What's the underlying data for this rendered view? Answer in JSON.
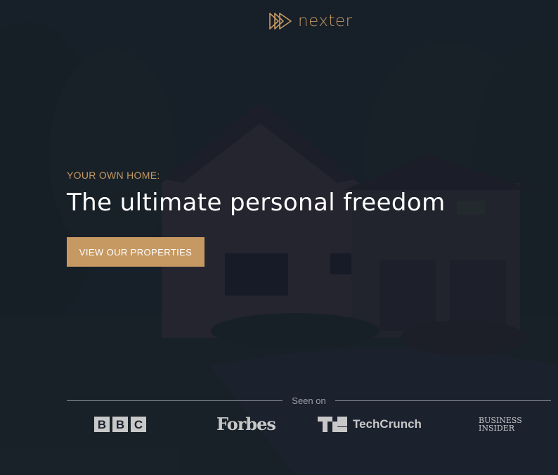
{
  "brand": {
    "name": "nexter",
    "logo_icon": "nexter-play-triangles-icon"
  },
  "hero": {
    "eyebrow": "YOUR OWN HOME:",
    "headline": "The ultimate personal freedom",
    "cta_label": "VIEW OUR PROPERTIES",
    "background_image": "house-at-dusk-photo"
  },
  "seen_on": {
    "label": "Seen on",
    "brands": [
      "BBC",
      "Forbes",
      "TechCrunch",
      "BUSINESS",
      "INSIDER"
    ]
  },
  "colors": {
    "accent": "#c69963",
    "overlay": "#10182a",
    "headline": "#ffffff",
    "cta_text": "#ffffff",
    "brand_logos": "#c8c8c8",
    "divider": "#8a8f99"
  }
}
